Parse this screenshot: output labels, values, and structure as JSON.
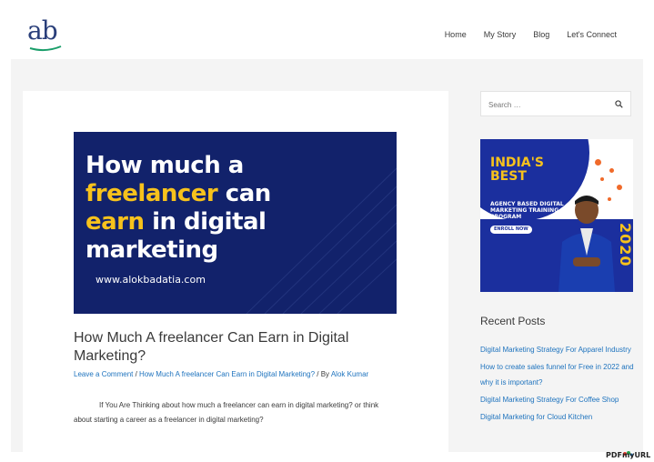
{
  "header": {
    "logo_text": "ab",
    "nav": [
      "Home",
      "My Story",
      "Blog",
      "Let's Connect"
    ]
  },
  "post": {
    "image": {
      "line1": "How much a",
      "line2a": "freelancer",
      "line2b": " can",
      "line3a": "earn",
      "line3b": " in digital",
      "line4": "marketing",
      "url": "www.alokbadatia.com"
    },
    "title": "How Much A freelancer Can Earn in Digital Marketing?",
    "meta": {
      "comment": "Leave a Comment",
      "sep1": " / ",
      "category": "How Much A freelancer Can Earn in Digital Marketing?",
      "sep2": " / By ",
      "author": "Alok Kumar"
    },
    "excerpt": "If You Are Thinking about how much a freelancer can earn in digital marketing? or think about starting a career as a freelancer in digital marketing?"
  },
  "sidebar": {
    "search_placeholder": "Search …",
    "ad": {
      "headline1": "INDIA'S",
      "headline2": "BEST",
      "sub": "AGENCY BASED DIGITAL MARKETING TRAINING PROGRAM",
      "cta": "ENROLL NOW",
      "year": "2020"
    },
    "recent_title": "Recent Posts",
    "recent_posts": [
      "Digital Marketing Strategy For Apparel Industry",
      "How to create sales funnel for Free in 2022 and why it is important?",
      "Digital Marketing Strategy For Coffee Shop",
      "Digital Marketing for Cloud Kitchen"
    ]
  },
  "watermark": "PDFmyURL",
  "colors": {
    "link": "#1e73be",
    "hero_bg": "#12226b",
    "accent_yellow": "#f7c21c",
    "ad_blue": "#1b2f9e"
  }
}
